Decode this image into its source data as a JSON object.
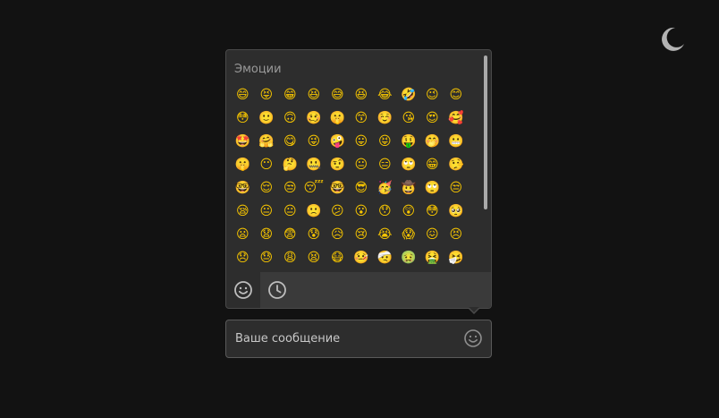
{
  "theme_toggle": {
    "icon": "moon-icon",
    "color": "#b3b3b3"
  },
  "picker": {
    "category_title": "Эмоции",
    "emojis": [
      "😄",
      "😝",
      "😁",
      "😆",
      "😅",
      "😆",
      "😂",
      "🤣",
      "😉",
      "😊",
      "😳",
      "🙂",
      "🙃",
      "🥴",
      "🤫",
      "😙",
      "☺️",
      "😘",
      "😍",
      "🥰",
      "🤩",
      "🤗",
      "😋",
      "😜",
      "🤪",
      "😛",
      "😝",
      "🤑",
      "🤭",
      "😬",
      "🤫",
      "😶",
      "🤔",
      "🤐",
      "🤨",
      "😐",
      "😑",
      "🙄",
      "😁",
      "🤥",
      "🤓",
      "😌",
      "😒",
      "😴",
      "🤓",
      "😎",
      "🥳",
      "🤠",
      "🙄",
      "😒",
      "😪",
      "😐",
      "😐",
      "🙁",
      "😕",
      "😮",
      "😯",
      "😲",
      "😳",
      "🥺",
      "😦",
      "😧",
      "😨",
      "😰",
      "😥",
      "😢",
      "😭",
      "😱",
      "😖",
      "😣",
      "😞",
      "😓",
      "😩",
      "😫",
      "😷",
      "🤒",
      "🤕",
      "🤢",
      "🤮",
      "🤧"
    ],
    "tabs": [
      {
        "name": "emotions",
        "icon": "smiley-icon"
      },
      {
        "name": "recent",
        "icon": "clock-icon"
      }
    ],
    "emoji_color": "#f5c400"
  },
  "composer": {
    "placeholder": "Ваше сообщение",
    "emoji_button_icon": "smiley-icon"
  }
}
